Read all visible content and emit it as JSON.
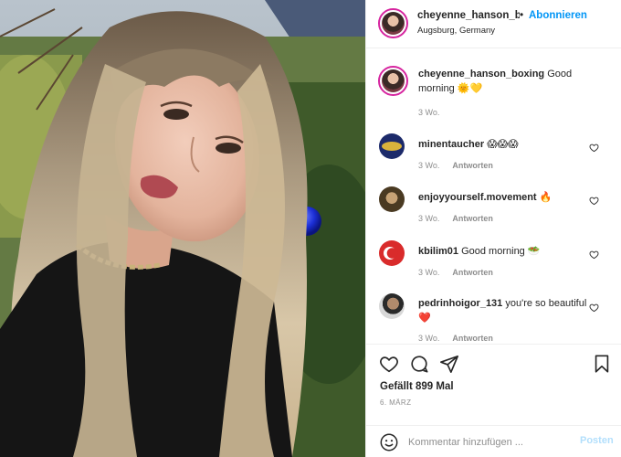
{
  "post": {
    "author": "cheyenne_hanson_boxing",
    "author_short": "cheyenne_hanson_bo",
    "follow_label": "Abonnieren",
    "separator": "•",
    "location": "Augsburg, Germany",
    "likes_text": "Gefällt 899 Mal",
    "date_text": "6. MÄRZ",
    "photo_alt": "Selfie"
  },
  "caption": {
    "username": "cheyenne_hanson_boxing",
    "text": "Good morning",
    "emoji": "🌞💛",
    "time": "3 Wo."
  },
  "comments": [
    {
      "username": "minentaucher",
      "text": "",
      "emoji": "😱😱😱",
      "time": "3 Wo.",
      "reply": "Antworten"
    },
    {
      "username": "enjoyyourself.movement",
      "text": "",
      "emoji": "🔥",
      "time": "3 Wo.",
      "reply": "Antworten"
    },
    {
      "username": "kbilim01",
      "text": "Good morning",
      "emoji": "🥗",
      "time": "3 Wo.",
      "reply": "Antworten"
    },
    {
      "username": "pedrinhoigor_131",
      "text": "you're so beautiful",
      "emoji": "❤️",
      "time": "3 Wo.",
      "reply": "Antworten"
    }
  ],
  "add_comment": {
    "placeholder": "Kommentar hinzufügen ...",
    "post_label": "Posten"
  },
  "colors": {
    "accent": "#0095f6",
    "post_disabled": "#b2dffc",
    "muted": "#8e8e8e",
    "border": "#efefef"
  },
  "icons": [
    "heart-icon",
    "comment-icon",
    "share-icon",
    "bookmark-icon",
    "emoji-icon",
    "small-heart-icon"
  ]
}
